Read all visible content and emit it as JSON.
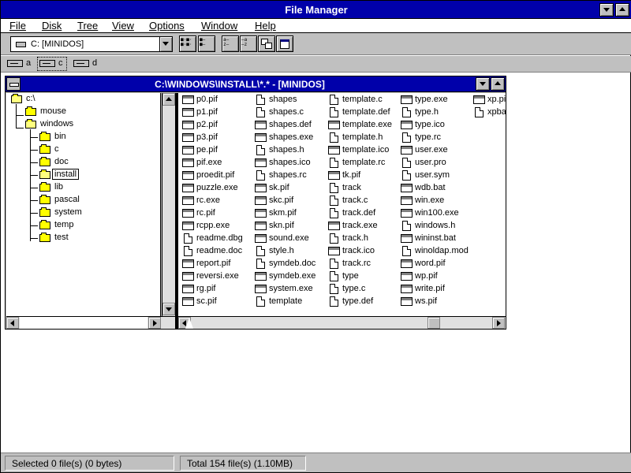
{
  "app": {
    "title": "File Manager"
  },
  "menu": [
    "File",
    "Disk",
    "Tree",
    "View",
    "Options",
    "Window",
    "Help"
  ],
  "toolbar": {
    "drive_value": "C: [MINIDOS]"
  },
  "drives": [
    "a",
    "c",
    "d"
  ],
  "child": {
    "title": "C:\\WINDOWS\\INSTALL\\*.* - [MINIDOS]"
  },
  "tree": [
    "c:\\",
    "mouse",
    "windows",
    "bin",
    "c",
    "doc",
    "install",
    "lib",
    "pascal",
    "system",
    "temp",
    "test"
  ],
  "files": [
    [
      "p0.pif",
      "p1.pif",
      "p2.pif",
      "p3.pif",
      "pe.pif",
      "pif.exe",
      "proedit.pif",
      "puzzle.exe",
      "rc.exe",
      "rc.pif",
      "rcpp.exe",
      "readme.dbg",
      "readme.doc",
      "report.pif",
      "reversi.exe",
      "rg.pif",
      "sc.pif"
    ],
    [
      "shapes",
      "shapes.c",
      "shapes.def",
      "shapes.exe",
      "shapes.h",
      "shapes.ico",
      "shapes.rc",
      "sk.pif",
      "skc.pif",
      "skm.pif",
      "skn.pif",
      "sound.exe",
      "style.h",
      "symdeb.doc",
      "symdeb.exe",
      "system.exe",
      "template"
    ],
    [
      "template.c",
      "template.def",
      "template.exe",
      "template.h",
      "template.ico",
      "template.rc",
      "tk.pif",
      "track",
      "track.c",
      "track.def",
      "track.exe",
      "track.h",
      "track.ico",
      "track.rc",
      "type",
      "type.c",
      "type.def"
    ],
    [
      "type.exe",
      "type.h",
      "type.ico",
      "type.rc",
      "user.exe",
      "user.pro",
      "user.sym",
      "wdb.bat",
      "win.exe",
      "win100.exe",
      "windows.h",
      "wininst.bat",
      "winoldap.mod",
      "word.pif",
      "wp.pif",
      "write.pif",
      "ws.pif"
    ],
    [
      "xp.pif",
      "xpbar"
    ]
  ],
  "doc_files": [
    "shapes",
    "shapes.c",
    "shapes.h",
    "shapes.rc",
    "template",
    "template.c",
    "template.def",
    "template.h",
    "template.rc",
    "track",
    "track.c",
    "track.def",
    "track.h",
    "track.rc",
    "type",
    "type.c",
    "type.def",
    "type.h",
    "type.rc",
    "user.pro",
    "user.sym",
    "readme.dbg",
    "readme.doc",
    "style.h",
    "symdeb.doc",
    "windows.h",
    "winoldap.mod",
    "xpbar"
  ],
  "status": {
    "selected": "Selected 0 file(s) (0 bytes)",
    "total": "Total 154 file(s) (1.10MB)"
  }
}
